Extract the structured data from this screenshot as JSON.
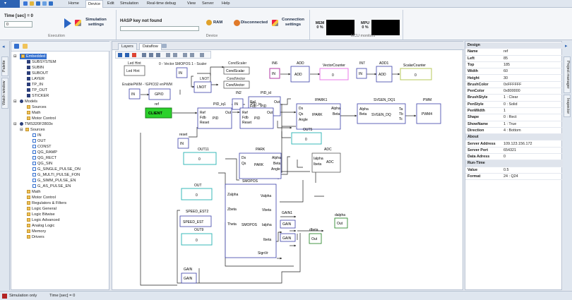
{
  "menu": {
    "items": [
      "Home",
      "Device",
      "Edit",
      "Simulation",
      "Real-time debug",
      "View",
      "Server",
      "Help"
    ],
    "active": "Device"
  },
  "ribbon": {
    "time_label": "Time [sec] = 0",
    "time_value": "0",
    "simulation_settings": "Simulation settings",
    "hasp_status": "HASP key not found",
    "ram_label": "RAM",
    "disconnected_label": "Disconnected",
    "connection_settings": "Connection settings",
    "mem_label": "MEM 0 %",
    "mpu_label": "MPU 0 %",
    "groups": {
      "execution": "Execution",
      "device": "Device",
      "mcu": "MCU monitors"
    }
  },
  "left_tabs": {
    "palette": "Palette",
    "watch": "Watch window"
  },
  "tree": {
    "embedded": "Embedded",
    "embedded_items": [
      "SUBSYSTEM",
      "SUBIN",
      "SUBOUT",
      "LAYER",
      "TP_IN",
      "TP_OUT",
      "STICKER"
    ],
    "models": "Models",
    "models_items": [
      "Sources",
      "Math",
      "Motor Control"
    ],
    "tms": "TMS320F2803x",
    "sources": "Sources",
    "sources_items": [
      "IN",
      "OUT",
      "CONST",
      "QG_RAMP",
      "QG_RECT",
      "QG_SIN",
      "G_SINGLE_PULSE_ON",
      "G_MULTI_PULSE_FON",
      "G_SIMM_PULSE_EN",
      "G_AS_PULSE_EN"
    ],
    "tms_items": [
      "Math",
      "Motor Control",
      "Regulators & Filters",
      "Logic General",
      "Logic Bitwise",
      "Logic Advanced",
      "Analog Logic",
      "Memory",
      "Drivers"
    ]
  },
  "canvas": {
    "tabs": [
      "Layers",
      "Dataflow"
    ],
    "active_tab": "Dataflow"
  },
  "diagram": {
    "labels": {
      "led_hint_top": "Led Hint",
      "led_hint": "Led Hint",
      "vector_smopos": "0 - Vector SMOPOS 1 - Scaler",
      "in": "IN",
      "cond_scaler_label": "CondScaler",
      "cond_scaler": "CondScalar",
      "lnot_top": "LNOT",
      "lnot": "LNOT",
      "cond_vector_label": "CondVector",
      "cond_vector": "CondVector",
      "enable_pwm": "EnablePWM - !GPIO32 enPWM",
      "gpio": "GPIO",
      "in6": "IN6",
      "add_top": "ADD",
      "add": "ADD",
      "vector_counter_label": "VectorCounter",
      "zero": "0",
      "in7": "IN7",
      "add1_top": "ADD1",
      "scalar_counter_label": "ScalarCounter",
      "in2": "IN2",
      "pid_id_top": "PID_id",
      "pid_iq1_top": "PID_iq1",
      "pid_iq_top": "PID_iq",
      "pid": "PID",
      "ref": "Ref",
      "fdb": "Fdb",
      "reset": "Reset",
      "out": "Out",
      "ref_label": "ref",
      "client": "CLIENT",
      "reset_label": "reset",
      "ipark1_top": "IPARK1",
      "ipark": "IPARK",
      "ds": "Ds",
      "qs": "Qs",
      "angle": "Angle",
      "alpha": "Alpha",
      "beta": "Beta",
      "svgen_top": "SVGEN_DQ1",
      "svgen": "SVGEN_DQ",
      "ta": "Ta",
      "tb": "Tb",
      "tc": "Tc",
      "pwm_top": "PWM",
      "pwm": "PWM4",
      "out5": "OUT5",
      "out11": "OUT11",
      "park_top": "PARK",
      "park": "PARK",
      "adc_top": "ADC",
      "adc": "ADC",
      "ialpha": "Ialpha",
      "ibeta": "Ibeta",
      "out_top": "OUT",
      "smopos_top": "SMOPOS",
      "smopos": "SMOPOS",
      "zalpha": "Zalpha",
      "zbeta": "Zbeta",
      "theta": "Theta",
      "valpha": "Valpha",
      "vbeta": "Vbeta",
      "sign_vr": "SignVr",
      "speed_est2": "SPEED_EST2",
      "speed_est": "SPEED_EST",
      "out9": "OUT9",
      "gain1": "GAIN1",
      "gain": "GAIN",
      "dalpha": "dalpha",
      "dbeta": "dbeta",
      "gain_top": "GAIN"
    }
  },
  "properties": {
    "rows": [
      {
        "k": "Design",
        "v": "",
        "cat": true
      },
      {
        "k": "Name",
        "v": "ref"
      },
      {
        "k": "Left",
        "v": "85"
      },
      {
        "k": "Top",
        "v": "185"
      },
      {
        "k": "Width",
        "v": "60"
      },
      {
        "k": "Height",
        "v": "30"
      },
      {
        "k": "BrushColor",
        "v": "0xFFFFFF"
      },
      {
        "k": "PenColor",
        "v": "0x800000"
      },
      {
        "k": "BrushStyle",
        "v": "1 : Clear"
      },
      {
        "k": "PenStyle",
        "v": "0 : Solid"
      },
      {
        "k": "PenWidth",
        "v": "1"
      },
      {
        "k": "Shape",
        "v": "0 : Rect"
      },
      {
        "k": "ShowName",
        "v": "1 : True"
      },
      {
        "k": "Direction",
        "v": "4 : Bottom"
      },
      {
        "k": "About",
        "v": "",
        "cat": true
      },
      {
        "k": "Server Address",
        "v": "109.123.156.172"
      },
      {
        "k": "Server Port",
        "v": "654321"
      },
      {
        "k": "Data Adress",
        "v": "0"
      },
      {
        "k": "Run-Time",
        "v": "",
        "cat": true
      },
      {
        "k": "Value",
        "v": "0.5"
      },
      {
        "k": "Format",
        "v": "24 : Q24"
      }
    ]
  },
  "right_tabs": {
    "project": "Project manager",
    "inspector": "Inspector"
  },
  "status": {
    "mode": "Simulation only",
    "time": "Time [sec] = 0"
  },
  "colors": {
    "accent": "#2d63b3",
    "block_border": "#3a3fa8",
    "wire": "#2a2a2a",
    "client_green": "#2bd12b",
    "counter_pink": "#e879e8",
    "counter_yellow": "#b7c95b",
    "out_cyan": "#39b8b8",
    "in_purple": "#b23aa6"
  }
}
